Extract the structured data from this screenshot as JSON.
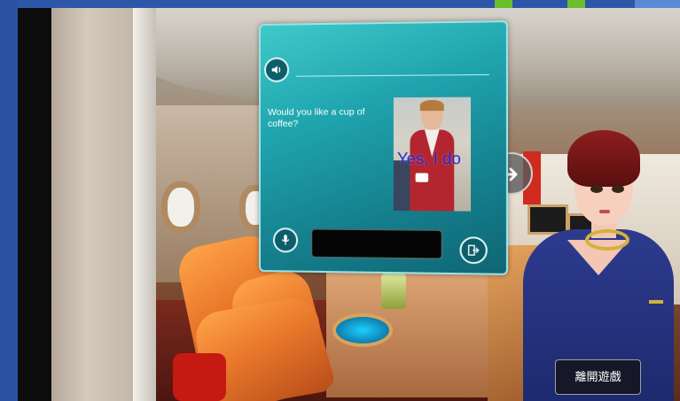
{
  "dialog": {
    "question_text": "Would you like a cup of coffee?",
    "image_caption": "Yes, I do",
    "answer_text": "",
    "speaker_icon": "speaker-icon",
    "mic_icon": "microphone-icon",
    "exit_icon": "exit-icon"
  },
  "scene": {
    "next_arrow_icon": "arrow-right-icon"
  },
  "controls": {
    "leave_game_label": "離開遊戲"
  },
  "colors": {
    "panel": "#1fa4ae",
    "panel_border": "#9be3e6",
    "caption": "#2222cc",
    "frame": "#2b52a2"
  }
}
